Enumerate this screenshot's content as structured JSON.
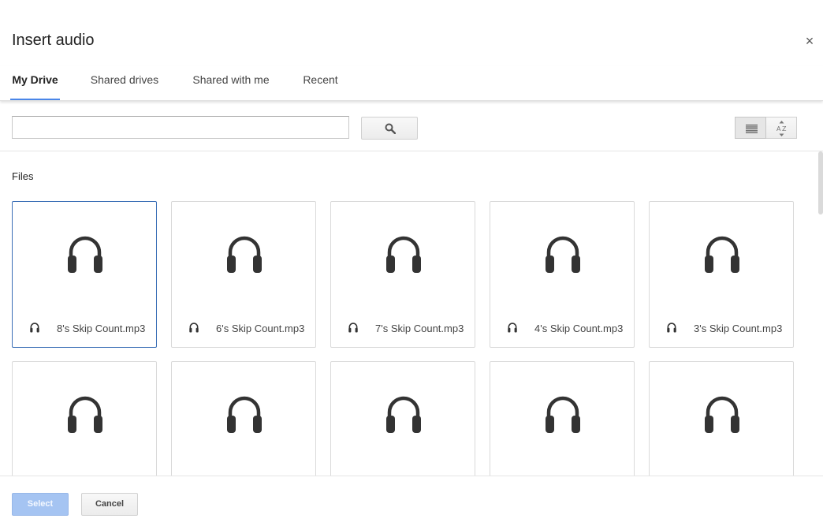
{
  "dialog": {
    "title": "Insert audio",
    "close_symbol": "×"
  },
  "tabs": [
    {
      "label": "My Drive",
      "active": true
    },
    {
      "label": "Shared drives",
      "active": false
    },
    {
      "label": "Shared with me",
      "active": false
    },
    {
      "label": "Recent",
      "active": false
    }
  ],
  "search": {
    "value": "",
    "placeholder": ""
  },
  "content": {
    "section_label": "Files",
    "files": [
      {
        "name": "8's Skip Count.mp3",
        "selected": true
      },
      {
        "name": "6's Skip Count.mp3",
        "selected": false
      },
      {
        "name": "7's Skip Count.mp3",
        "selected": false
      },
      {
        "name": "4's Skip Count.mp3",
        "selected": false
      },
      {
        "name": "3's Skip Count.mp3",
        "selected": false
      },
      {
        "name": "",
        "selected": false
      },
      {
        "name": "",
        "selected": false
      },
      {
        "name": "",
        "selected": false
      },
      {
        "name": "",
        "selected": false
      },
      {
        "name": "",
        "selected": false
      }
    ]
  },
  "footer": {
    "select_label": "Select",
    "cancel_label": "Cancel"
  },
  "icons": {
    "file": "headphones-icon",
    "search": "search-icon",
    "list_view": "list-view-icon",
    "sort": "sort-az-icon",
    "close": "close-icon"
  },
  "colors": {
    "accent": "#4a86e8",
    "selected_border": "#3b6fb6",
    "select_button": "#a5c4f2"
  }
}
